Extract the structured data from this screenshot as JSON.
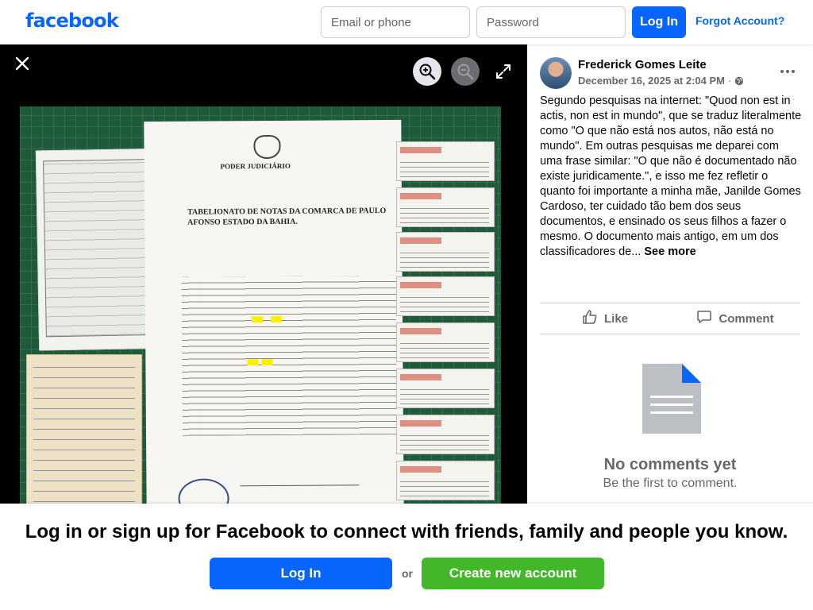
{
  "header": {
    "logo_text": "facebook",
    "email_placeholder": "Email or phone",
    "password_placeholder": "Password",
    "login_label": "Log In",
    "forgot_label": "Forgot Account?"
  },
  "media": {
    "close_icon": "close-icon",
    "zoom_in_icon": "zoom-in-icon",
    "zoom_out_icon": "zoom-out-icon",
    "fullscreen_icon": "expand-icon",
    "photo_texts": {
      "header": "PODER JUDICIÁRIO",
      "title": "TABELIONATO DE NOTAS DA COMARCA DE PAULO AFONSO ESTADO DA BAHIA."
    }
  },
  "post": {
    "author": "Frederick Gomes Leite",
    "date": "December 16, 2025 at 2:04 PM",
    "separator": "·",
    "text": "Segundo pesquisas na internet: \"Quod non est in actis, non est in mundo\", que se traduz literalmente como \"O que não está nos autos, não está no mundo\". Em outras pesquisas me deparei com uma frase similar: \"O que não é documentado não existe juridicamente.\", e isso me fez refletir o quanto foi importante a minha mãe, Janilde Gomes Cardoso, ter cuidado tão bem dos seus documentos, e ensinado os seus filhos a fazer o mesmo. O documento mais antigo, em um dos classificadores de...",
    "see_more": "See more",
    "like_label": "Like",
    "comment_label": "Comment",
    "no_comments_title": "No comments yet",
    "no_comments_subtitle": "Be the first to comment."
  },
  "banner": {
    "text": "Log in or sign up for Facebook to connect with friends, family and people you know.",
    "login_label": "Log In",
    "or_label": "or",
    "create_label": "Create new account"
  },
  "colors": {
    "brand_blue": "#0866ff",
    "create_green": "#42b72a",
    "muted_text": "#65676b"
  }
}
